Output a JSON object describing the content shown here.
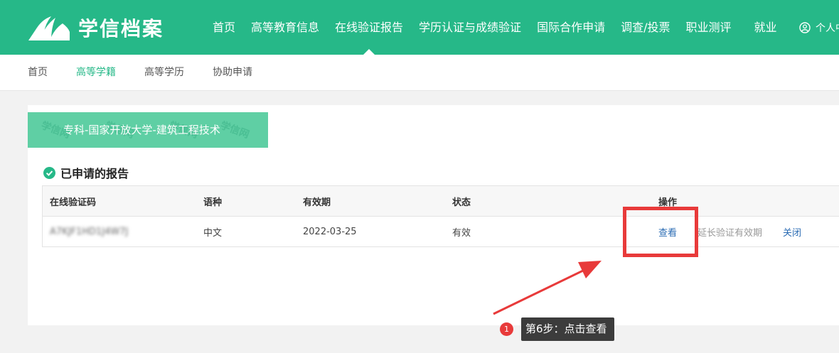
{
  "header": {
    "logo_text": "学信档案",
    "nav": [
      {
        "label": "首页"
      },
      {
        "label": "高等教育信息"
      },
      {
        "label": "在线验证报告",
        "active": true
      },
      {
        "label": "学历认证与成绩验证"
      },
      {
        "label": "国际合作申请"
      },
      {
        "label": "调查/投票"
      },
      {
        "label": "职业测评"
      },
      {
        "label": "就业"
      }
    ],
    "user_label": "个人中心",
    "bg_color": "#26b888"
  },
  "subnav": {
    "items": [
      {
        "label": "首页"
      },
      {
        "label": "高等学籍",
        "active": true
      },
      {
        "label": "高等学历"
      },
      {
        "label": "协助申请"
      }
    ],
    "active_color": "#26b888"
  },
  "card": {
    "banner_label": "专科-国家开放大学-建筑工程技术",
    "watermark_text": "学信网",
    "section_title": "已申请的报告",
    "table": {
      "headers": {
        "code": "在线验证码",
        "language": "语种",
        "validity": "有效期",
        "status": "状态",
        "action": "操作"
      },
      "rows": [
        {
          "code": "A7KJF1HD1J4W7J",
          "language": "中文",
          "validity": "2022-03-25",
          "status": "有效",
          "actions": {
            "view": "查看",
            "extend": "延长验证有效期",
            "close": "关闭"
          }
        }
      ]
    }
  },
  "annotation": {
    "step_number": "1",
    "step_text": "第6步：点击查看",
    "highlight_color": "#e83a3a"
  }
}
